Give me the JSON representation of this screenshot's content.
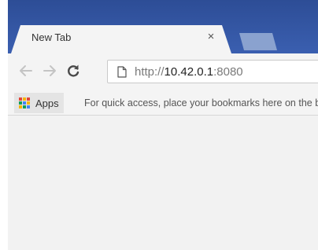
{
  "tab": {
    "title": "New Tab",
    "close_glyph": "×"
  },
  "toolbar": {
    "back_icon": "back-arrow-icon",
    "forward_icon": "forward-arrow-icon",
    "reload_icon": "reload-icon"
  },
  "omnibox": {
    "scheme": "http://",
    "host": "10.42.0.1",
    "port": ":8080",
    "icon": "page-icon"
  },
  "bookmarks": {
    "apps_label": "Apps",
    "hint": "For quick access, place your bookmarks here on the bookmarks bar."
  },
  "colors": {
    "titlebar": "#3c61b3",
    "tab": "#f4f4f4",
    "page_background": "#f2f2f2"
  }
}
